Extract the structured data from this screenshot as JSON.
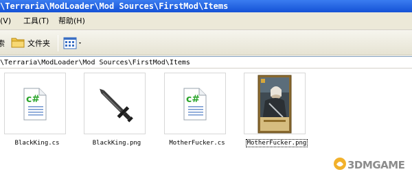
{
  "window": {
    "title": "\\Terraria\\ModLoader\\Mod Sources\\FirstMod\\Items"
  },
  "menu": {
    "items": [
      "(V)",
      "工具(T)",
      "帮助(H)"
    ]
  },
  "toolbar": {
    "left_fragment": "索",
    "folders_label": "文件夹"
  },
  "address": {
    "path": "\\Terraria\\ModLoader\\Mod Sources\\FirstMod\\Items"
  },
  "files": [
    {
      "name": "BlackKing.cs",
      "icon": "csharp-file-icon"
    },
    {
      "name": "BlackKing.png",
      "icon": "sword-image-icon"
    },
    {
      "name": "MotherFucker.cs",
      "icon": "csharp-file-icon"
    },
    {
      "name": "MotherFucker.png",
      "icon": "card-image-icon",
      "selected": true
    }
  ],
  "watermark": {
    "text": "3DMGAME"
  },
  "colors": {
    "titlebar": "#1a5ad9",
    "toolbar": "#ece9d8",
    "csharp": "#2aa52a"
  }
}
